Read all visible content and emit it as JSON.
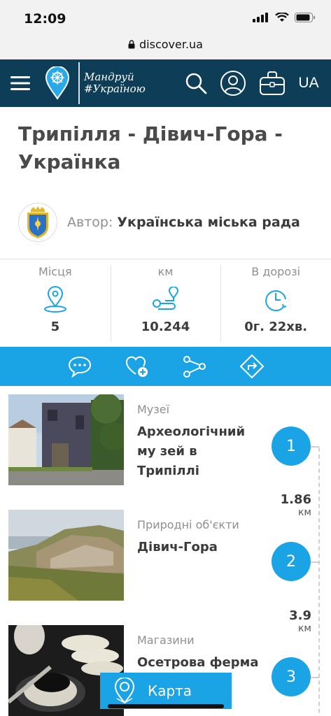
{
  "status_bar": {
    "time": "12:09"
  },
  "browser": {
    "url": "discover.ua"
  },
  "header": {
    "brand": "Мандруй #Україною",
    "lang": "UA"
  },
  "page": {
    "title": "Трипілля - Дівич-Гора - Українка",
    "author_label": "Автор:",
    "author_name": "Українська міська рада"
  },
  "stats": [
    {
      "label": "Місця",
      "value": "5",
      "icon": "map-pin-icon"
    },
    {
      "label": "км",
      "value": "10.244",
      "icon": "route-icon"
    },
    {
      "label": "В дорозі",
      "value": "0г. 22хв.",
      "icon": "clock-icon"
    }
  ],
  "actions": [
    {
      "icon": "comment-icon"
    },
    {
      "icon": "heart-add-icon"
    },
    {
      "icon": "share-icon"
    },
    {
      "icon": "directions-icon"
    }
  ],
  "route_items": [
    {
      "category": "Музеї",
      "name": "Археологічний му зей в Трипіллі",
      "index": "1"
    },
    {
      "category": "Природні об'єкти",
      "name": "Дівич-Гора",
      "index": "2"
    },
    {
      "category": "Магазини",
      "name": "Осетрова ферма “",
      "index": "3"
    }
  ],
  "distances": [
    {
      "value": "1.86",
      "unit": "км"
    },
    {
      "value": "3.9",
      "unit": "км"
    }
  ],
  "map_button": {
    "label": "Карта"
  },
  "colors": {
    "header_bg": "#0e3d58",
    "accent": "#1aa3e5"
  }
}
